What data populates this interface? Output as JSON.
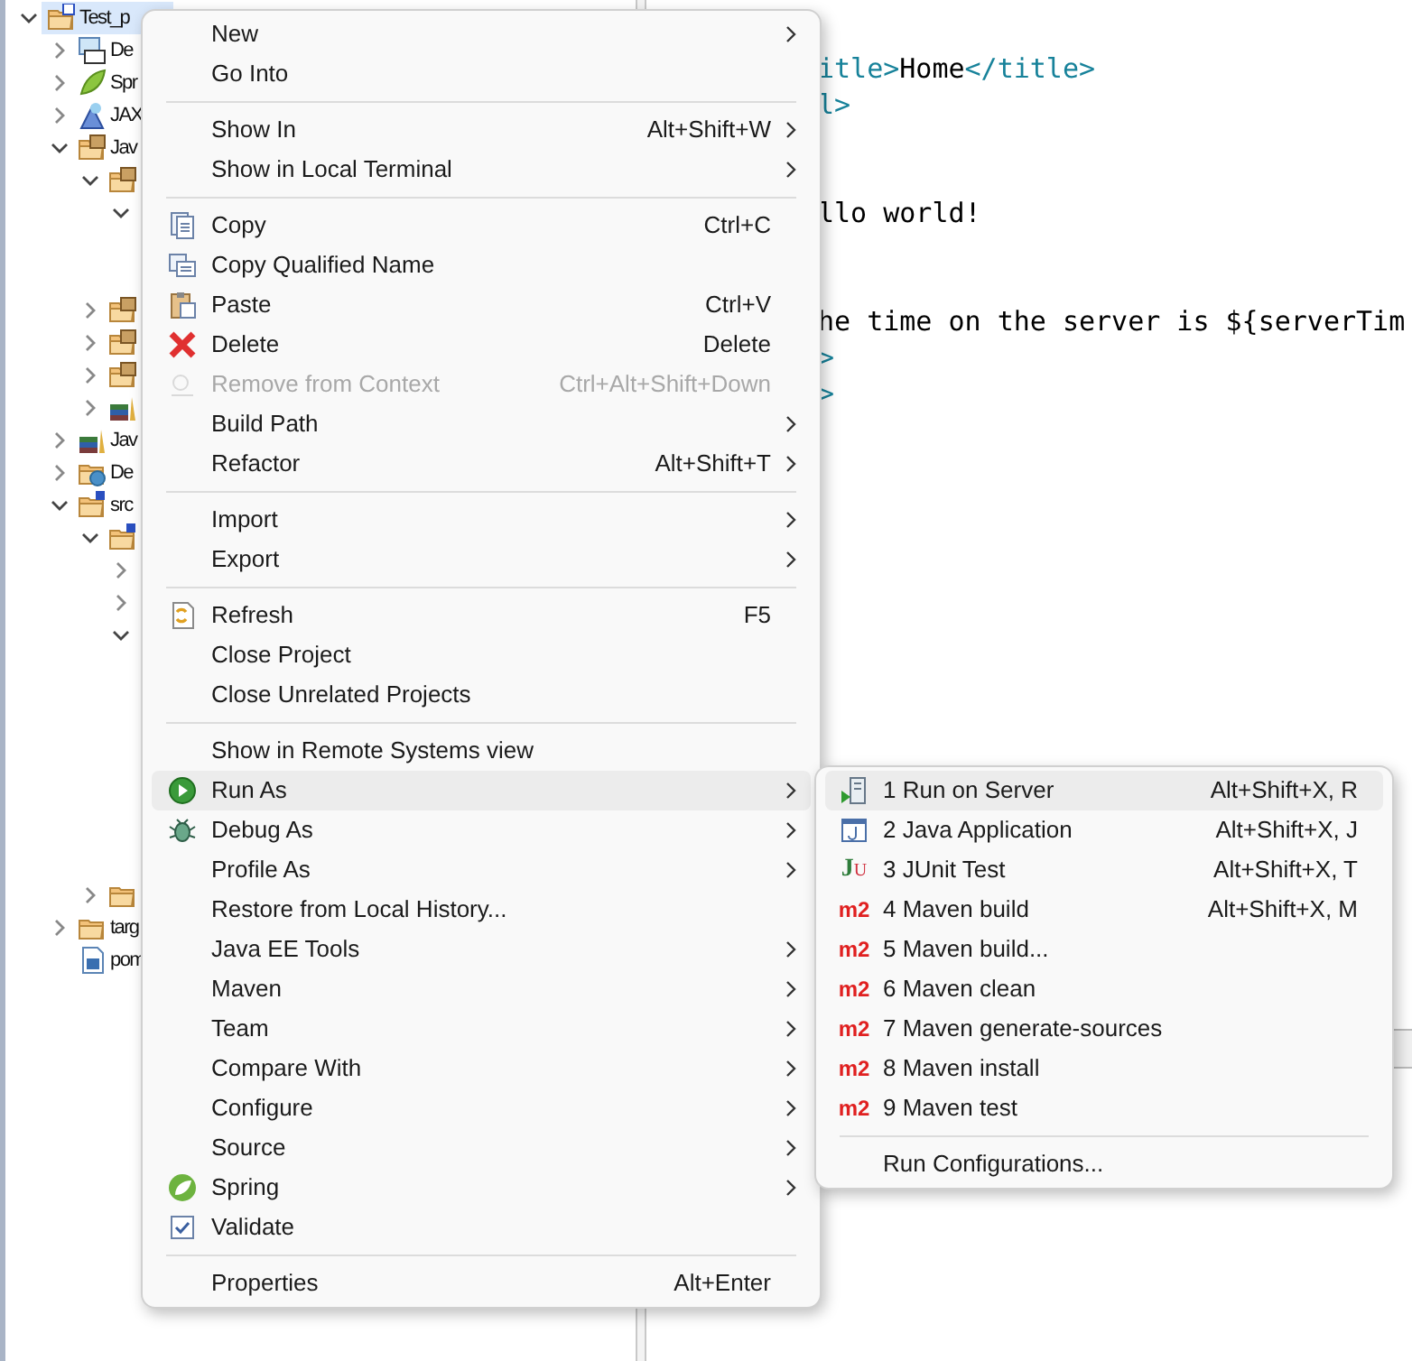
{
  "tree": [
    {
      "label": "Test_p",
      "kind": "project",
      "expanded": true,
      "selected": true,
      "children": [
        {
          "label": "De",
          "kind": "descriptor",
          "expanded": false,
          "selected": false
        },
        {
          "label": "Spr",
          "kind": "leaf",
          "expanded": false,
          "selected": false
        },
        {
          "label": "JAX",
          "kind": "webservice",
          "expanded": false,
          "selected": false
        },
        {
          "label": "Jav",
          "kind": "package-root",
          "expanded": true,
          "selected": false,
          "children": [
            {
              "kind": "package",
              "expanded": true,
              "selected": false,
              "children": [
                {
                  "expanded": true,
                  "selected": false
                }
              ]
            },
            {
              "kind": "package",
              "expanded": false,
              "selected": false
            },
            {
              "kind": "package",
              "expanded": false,
              "selected": false
            },
            {
              "kind": "package",
              "expanded": false,
              "selected": false
            },
            {
              "kind": "library",
              "expanded": false,
              "selected": false
            }
          ]
        },
        {
          "label": "Jav",
          "kind": "library",
          "expanded": false,
          "selected": false
        },
        {
          "label": "De",
          "kind": "deployed",
          "expanded": false,
          "selected": false
        },
        {
          "label": "src",
          "kind": "source-folder",
          "expanded": true,
          "selected": false,
          "children": [
            {
              "kind": "source-folder",
              "expanded": true,
              "selected": false,
              "children": [
                {
                  "expanded": false,
                  "selected": false
                },
                {
                  "expanded": false,
                  "selected": false
                },
                {
                  "expanded": true,
                  "selected": false
                }
              ]
            },
            {
              "kind": "folder",
              "expanded": false,
              "selected": false
            }
          ]
        },
        {
          "label": "targ",
          "kind": "folder",
          "expanded": false,
          "selected": false
        },
        {
          "label": "pom",
          "kind": "maven-file",
          "selected": false
        }
      ]
    }
  ],
  "editor": {
    "lines": [
      {
        "parts": [
          {
            "text": "itle>",
            "kind": "tag"
          },
          {
            "text": "Home",
            "kind": "text"
          },
          {
            "text": "</title>",
            "kind": "tag"
          }
        ]
      },
      {
        "parts": [
          {
            "text": "l>",
            "kind": "tag"
          }
        ]
      },
      {
        "parts": [
          {
            "text": "llo world!",
            "kind": "text"
          }
        ]
      },
      {
        "parts": [
          {
            "text": "he time on the server is ${serverTim",
            "kind": "text"
          }
        ]
      },
      {
        "parts": [
          {
            "text": ">",
            "kind": "tag"
          }
        ]
      },
      {
        "parts": [
          {
            "text": ">",
            "kind": "tag"
          }
        ]
      }
    ]
  },
  "context_menu": {
    "groups": [
      [
        {
          "label": "New",
          "submenu": true,
          "selected": false,
          "disabled": false
        },
        {
          "label": "Go Into",
          "submenu": false,
          "selected": false,
          "disabled": false
        }
      ],
      [
        {
          "label": "Show In",
          "shortcut": "Alt+Shift+W",
          "submenu": true,
          "selected": false,
          "disabled": false
        },
        {
          "label": "Show in Local Terminal",
          "submenu": true,
          "selected": false,
          "disabled": false
        }
      ],
      [
        {
          "label": "Copy",
          "kind": "copy",
          "shortcut": "Ctrl+C",
          "submenu": false,
          "selected": false,
          "disabled": false
        },
        {
          "label": "Copy Qualified Name",
          "kind": "copy-qualified",
          "submenu": false,
          "selected": false,
          "disabled": false
        },
        {
          "label": "Paste",
          "kind": "paste",
          "shortcut": "Ctrl+V",
          "submenu": false,
          "selected": false,
          "disabled": false
        },
        {
          "label": "Delete",
          "kind": "delete",
          "shortcut": "Delete",
          "submenu": false,
          "selected": false,
          "disabled": false
        },
        {
          "label": "Remove from Context",
          "kind": "remove",
          "shortcut": "Ctrl+Alt+Shift+Down",
          "submenu": false,
          "selected": false,
          "disabled": true
        },
        {
          "label": "Build Path",
          "submenu": true,
          "selected": false,
          "disabled": false
        },
        {
          "label": "Refactor",
          "shortcut": "Alt+Shift+T",
          "submenu": true,
          "selected": false,
          "disabled": false
        }
      ],
      [
        {
          "label": "Import",
          "submenu": true,
          "selected": false,
          "disabled": false
        },
        {
          "label": "Export",
          "submenu": true,
          "selected": false,
          "disabled": false
        }
      ],
      [
        {
          "label": "Refresh",
          "kind": "refresh",
          "shortcut": "F5",
          "submenu": false,
          "selected": false,
          "disabled": false
        },
        {
          "label": "Close Project",
          "submenu": false,
          "selected": false,
          "disabled": false
        },
        {
          "label": "Close Unrelated Projects",
          "submenu": false,
          "selected": false,
          "disabled": false
        }
      ],
      [
        {
          "label": "Show in Remote Systems view",
          "submenu": false,
          "selected": false,
          "disabled": false
        },
        {
          "label": "Run As",
          "kind": "run",
          "submenu": true,
          "selected": true,
          "disabled": false
        },
        {
          "label": "Debug As",
          "kind": "debug",
          "submenu": true,
          "selected": false,
          "disabled": false
        },
        {
          "label": "Profile As",
          "submenu": true,
          "selected": false,
          "disabled": false
        },
        {
          "label": "Restore from Local History...",
          "submenu": false,
          "selected": false,
          "disabled": false
        },
        {
          "label": "Java EE Tools",
          "submenu": true,
          "selected": false,
          "disabled": false
        },
        {
          "label": "Maven",
          "submenu": true,
          "selected": false,
          "disabled": false
        },
        {
          "label": "Team",
          "submenu": true,
          "selected": false,
          "disabled": false
        },
        {
          "label": "Compare With",
          "submenu": true,
          "selected": false,
          "disabled": false
        },
        {
          "label": "Configure",
          "submenu": true,
          "selected": false,
          "disabled": false
        },
        {
          "label": "Source",
          "submenu": true,
          "selected": false,
          "disabled": false
        },
        {
          "label": "Spring",
          "kind": "spring",
          "submenu": true,
          "selected": false,
          "disabled": false
        },
        {
          "label": "Validate",
          "kind": "validate",
          "submenu": false,
          "selected": false,
          "disabled": false
        }
      ],
      [
        {
          "label": "Properties",
          "shortcut": "Alt+Enter",
          "submenu": false,
          "selected": false,
          "disabled": false
        }
      ]
    ]
  },
  "run_as_submenu": {
    "groups": [
      [
        {
          "label": "1 Run on Server",
          "kind": "server",
          "shortcut": "Alt+Shift+X, R",
          "selected": true
        },
        {
          "label": "2 Java Application",
          "kind": "java-app",
          "shortcut": "Alt+Shift+X, J",
          "selected": false
        },
        {
          "label": "3 JUnit Test",
          "kind": "junit",
          "icon_text": "JU",
          "shortcut": "Alt+Shift+X, T",
          "selected": false
        },
        {
          "label": "4 Maven build",
          "kind": "maven",
          "icon_text": "m2",
          "shortcut": "Alt+Shift+X, M",
          "selected": false
        },
        {
          "label": "5 Maven build...",
          "kind": "maven",
          "icon_text": "m2",
          "selected": false
        },
        {
          "label": "6 Maven clean",
          "kind": "maven",
          "icon_text": "m2",
          "selected": false
        },
        {
          "label": "7 Maven generate-sources",
          "kind": "maven",
          "icon_text": "m2",
          "selected": false
        },
        {
          "label": "8 Maven install",
          "kind": "maven",
          "icon_text": "m2",
          "selected": false
        },
        {
          "label": "9 Maven test",
          "kind": "maven",
          "icon_text": "m2",
          "selected": false
        }
      ],
      [
        {
          "label": "Run Configurations...",
          "selected": false
        }
      ]
    ]
  }
}
